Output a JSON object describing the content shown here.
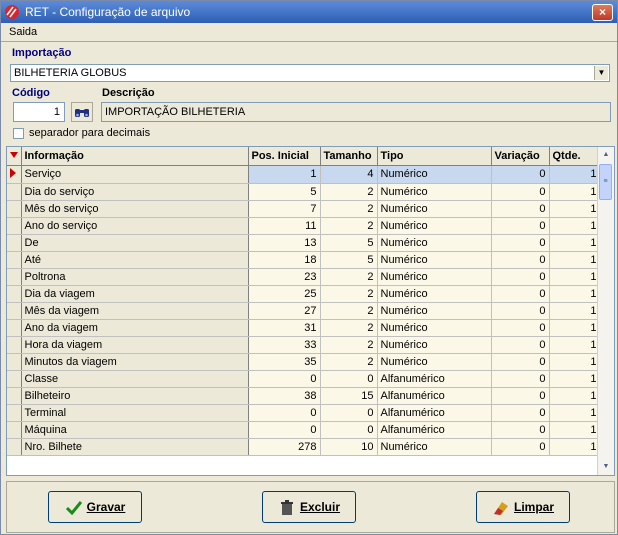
{
  "window": {
    "title": "RET - Configuração de arquivo",
    "close_glyph": "×"
  },
  "menu": {
    "items": [
      "Saida"
    ]
  },
  "importacao": {
    "label": "Importação",
    "value": "BILHETERIA GLOBUS"
  },
  "codigo": {
    "label": "Código",
    "value": "1"
  },
  "descricao": {
    "label": "Descrição",
    "value": "IMPORTAÇÃO BILHETERIA"
  },
  "separador": {
    "label": "separador para decimais",
    "checked": false
  },
  "grid": {
    "columns": [
      "Informação",
      "Pos. Inicial",
      "Tamanho",
      "Tipo",
      "Variação",
      "Qtde."
    ],
    "rows": [
      [
        "Serviço",
        "1",
        "4",
        "Numérico",
        "0",
        "1"
      ],
      [
        "Dia do serviço",
        "5",
        "2",
        "Numérico",
        "0",
        "1"
      ],
      [
        "Mês do serviço",
        "7",
        "2",
        "Numérico",
        "0",
        "1"
      ],
      [
        "Ano do serviço",
        "11",
        "2",
        "Numérico",
        "0",
        "1"
      ],
      [
        "De",
        "13",
        "5",
        "Numérico",
        "0",
        "1"
      ],
      [
        "Até",
        "18",
        "5",
        "Numérico",
        "0",
        "1"
      ],
      [
        "Poltrona",
        "23",
        "2",
        "Numérico",
        "0",
        "1"
      ],
      [
        "Dia da viagem",
        "25",
        "2",
        "Numérico",
        "0",
        "1"
      ],
      [
        "Mês da viagem",
        "27",
        "2",
        "Numérico",
        "0",
        "1"
      ],
      [
        "Ano da viagem",
        "31",
        "2",
        "Numérico",
        "0",
        "1"
      ],
      [
        "Hora da viagem",
        "33",
        "2",
        "Numérico",
        "0",
        "1"
      ],
      [
        "Minutos da viagem",
        "35",
        "2",
        "Numérico",
        "0",
        "1"
      ],
      [
        "Classe",
        "0",
        "0",
        "Alfanumérico",
        "0",
        "1"
      ],
      [
        "Bilheteiro",
        "38",
        "15",
        "Alfanumérico",
        "0",
        "1"
      ],
      [
        "Terminal",
        "0",
        "0",
        "Alfanumérico",
        "0",
        "1"
      ],
      [
        "Máquina",
        "0",
        "0",
        "Alfanumérico",
        "0",
        "1"
      ],
      [
        "Nro. Bilhete",
        "278",
        "10",
        "Numérico",
        "0",
        "1"
      ]
    ],
    "selected_row": 0
  },
  "buttons": {
    "gravar": "Gravar",
    "excluir": "Excluir",
    "limpar": "Limpar"
  },
  "colors": {
    "title_bar": "#2f5fb4",
    "label_blue": "#00007e",
    "selection": "#c8d8ee",
    "indicator": "#cc0000"
  }
}
